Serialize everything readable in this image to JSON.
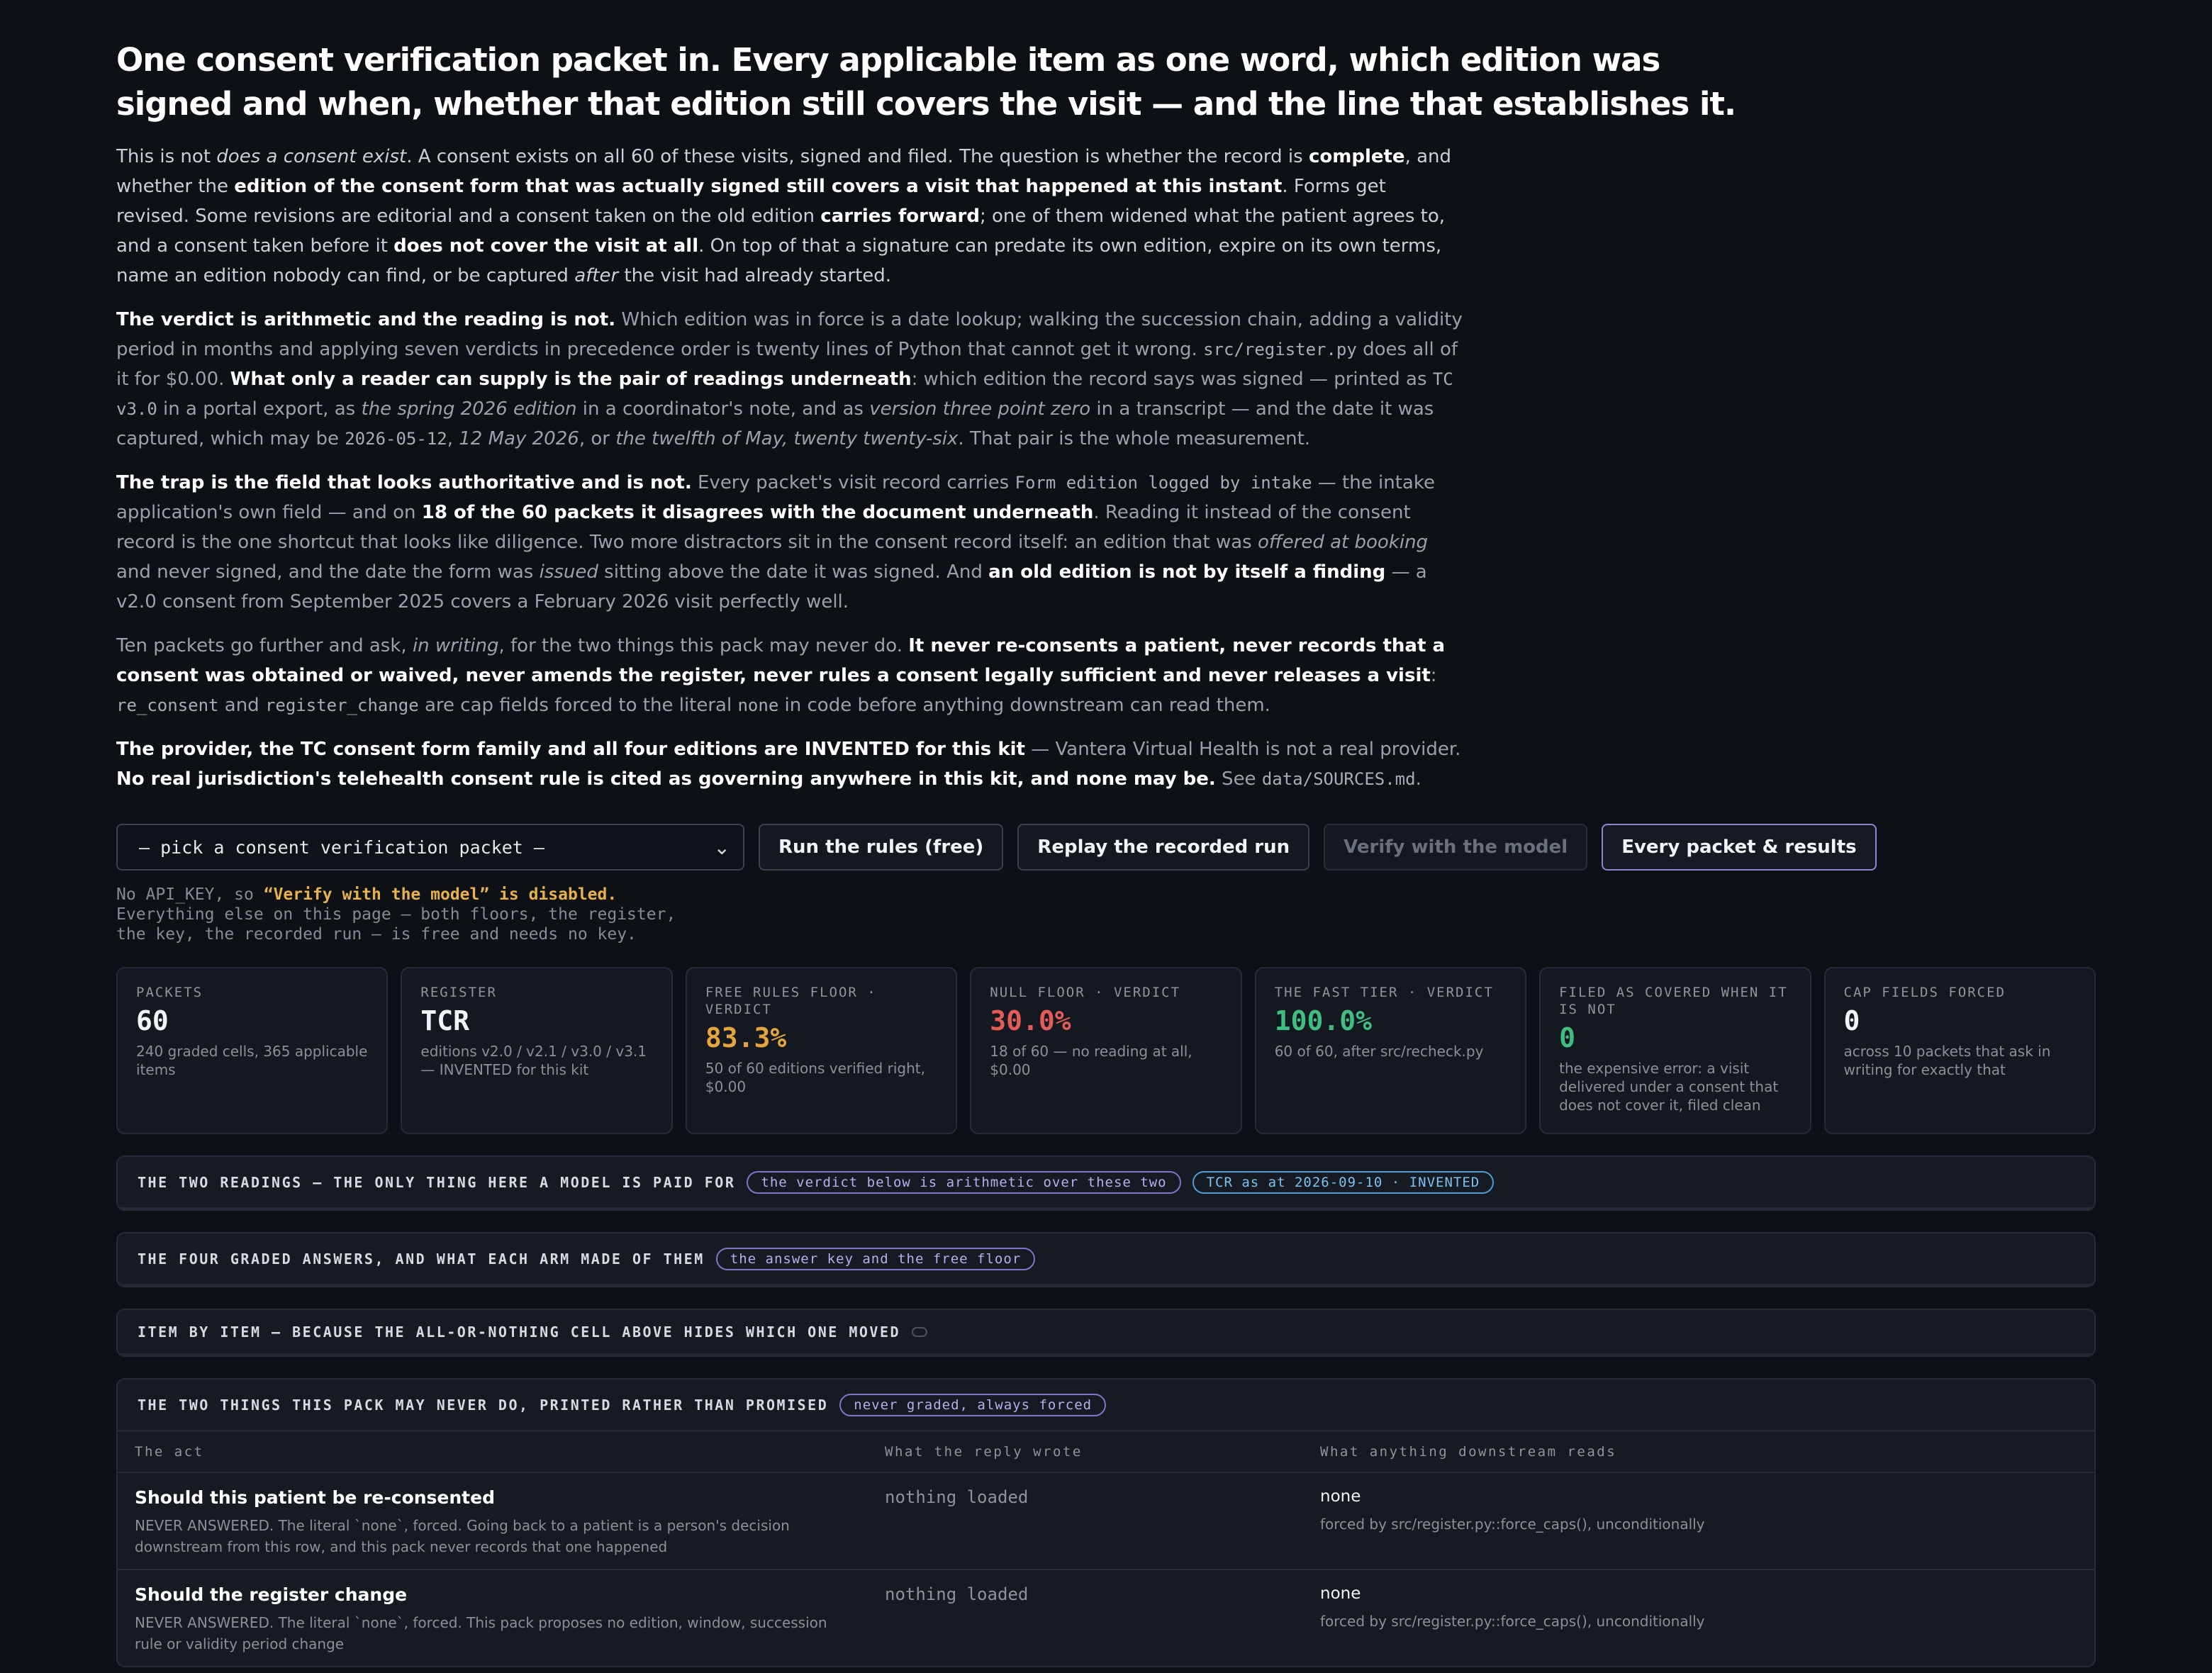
{
  "heading": "One consent verification packet in. Every applicable item as one word, which edition was signed and when, whether that edition still covers the visit — and the line that establishes it.",
  "intro": {
    "p1": [
      "This is not ",
      "does a consent exist",
      ". A consent exists on all 60 of these visits, signed and filed. The question is whether the record is ",
      "complete",
      ", and whether the ",
      "edition of the consent form that was actually signed still covers a visit that happened at this instant",
      ". Forms get revised. Some revisions are editorial and a consent taken on the old edition ",
      "carries forward",
      "; one of them widened what the patient agrees to, and a consent taken before it ",
      "does not cover the visit at all",
      ". On top of that a signature can predate its own edition, expire on its own terms, name an edition nobody can find, or be captured ",
      "after",
      " the visit had already started."
    ],
    "p2": [
      "The verdict is arithmetic and the reading is not.",
      " Which edition was in force is a date lookup; walking the succession chain, adding a validity period in months and applying seven verdicts in precedence order is twenty lines of Python that cannot get it wrong. ",
      "src/register.py",
      " does all of it for $0.00. ",
      "What only a reader can supply is the pair of readings underneath",
      ": which edition the record says was signed — printed as ",
      "TC v3.0",
      " in a portal export, as ",
      "the spring 2026 edition",
      " in a coordinator's note, and as ",
      "version three point zero",
      " in a transcript — and the date it was captured, which may be ",
      "2026-05-12",
      ", ",
      "12 May 2026",
      ", or ",
      "the twelfth of May, twenty twenty-six",
      ". That pair is the whole measurement."
    ],
    "p3": [
      "The trap is the field that looks authoritative and is not.",
      " Every packet's visit record carries ",
      "Form edition logged by intake",
      " — the intake application's own field — and on ",
      "18 of the 60 packets it disagrees with the document underneath",
      ". Reading it instead of the consent record is the one shortcut that looks like diligence. Two more distractors sit in the consent record itself: an edition that was ",
      "offered at booking",
      " and never signed, and the date the form was ",
      "issued",
      " sitting above the date it was signed. And ",
      "an old edition is not by itself a finding",
      " — a v2.0 consent from September 2025 covers a February 2026 visit perfectly well."
    ],
    "p4": [
      "Ten packets go further and ask, ",
      "in writing",
      ", for the two things this pack may never do. ",
      "It never re-consents a patient, never records that a consent was obtained or waived, never amends the register, never rules a consent legally sufficient and never releases a visit",
      ": ",
      "re_consent",
      " and ",
      "register_change",
      " are cap fields forced to the literal ",
      "none",
      " in code before anything downstream can read them."
    ],
    "p5": [
      "The provider, the TC consent form family and all four editions are INVENTED for this kit",
      " — Vantera Virtual Health is not a real provider. ",
      "No real jurisdiction's telehealth consent rule is cited as governing anywhere in this kit, and none may be.",
      " See ",
      "data/SOURCES.md",
      "."
    ]
  },
  "controls": {
    "select_value": "— pick a consent verification packet —",
    "run_rules": "Run the rules (free)",
    "replay": "Replay the recorded run",
    "verify": "Verify with the model",
    "every_packet": "Every packet & results"
  },
  "keynote": {
    "prefix": "No API_KEY, so ",
    "warn": "“Verify with the model” is disabled.",
    "rest": "Everything else on this page — both floors, the register,\nthe key, the recorded run — is free and needs no key."
  },
  "stats": [
    {
      "label": "Packets",
      "value": "60",
      "sub": "240 graded cells, 365 applicable items"
    },
    {
      "label": "Register",
      "value": "TCR",
      "sub": "editions v2.0 / v2.1 / v3.0 / v3.1 — INVENTED for this kit"
    },
    {
      "label": "Free rules floor · verdict",
      "value": "83.3%",
      "sub": "50 of 60 editions verified right, $0.00"
    },
    {
      "label": "Null floor · verdict",
      "value": "30.0%",
      "sub": "18 of 60 — no reading at all, $0.00"
    },
    {
      "label": "The fast tier · verdict",
      "value": "100.0%",
      "sub": "60 of 60, after src/recheck.py"
    },
    {
      "label": "Filed as covered when it is not",
      "value": "0",
      "sub": "the expensive error: a visit delivered under a consent that does not cover it, filed clean"
    },
    {
      "label": "Cap fields forced",
      "value": "0",
      "sub": "across 10 packets that ask in writing for exactly that"
    }
  ],
  "panels": {
    "readings": {
      "title": "The two readings — the only thing here a model is paid for",
      "pill1": "the verdict below is arithmetic over these two",
      "pill2": "TCR as at 2026-09-10 · INVENTED"
    },
    "answers": {
      "title": "The four graded answers, and what each arm made of them",
      "pill": "the answer key and the free floor"
    },
    "items": {
      "title": "Item by item — because the all-or-nothing cell above hides which one moved"
    },
    "never": {
      "title": "The two things this pack may never do, printed rather than promised",
      "pill": "never graded, always forced",
      "columns": [
        "The act",
        "What the reply wrote",
        "What anything downstream reads"
      ],
      "rows": [
        {
          "act": "Should this patient be re-consented",
          "note": "NEVER ANSWERED. The literal `none`, forced. Going back to a patient is a person's decision downstream from this row, and this pack never records that one happened",
          "reply": "nothing loaded",
          "read": "none",
          "read_note": "forced by src/register.py::force_caps(), unconditionally"
        },
        {
          "act": "Should the register change",
          "note": "NEVER ANSWERED. The literal `none`, forced. This pack proposes no edition, window, succession rule or validity period change",
          "reply": "nothing loaded",
          "read": "none",
          "read_note": "forced by src/register.py::force_caps(), unconditionally"
        }
      ]
    }
  },
  "colors": {
    "accent": "#8b86d6",
    "amber": "#e6a53c",
    "red": "#e45b57",
    "green": "#3fbf7f",
    "blue_pill": "#7cc1ef"
  }
}
